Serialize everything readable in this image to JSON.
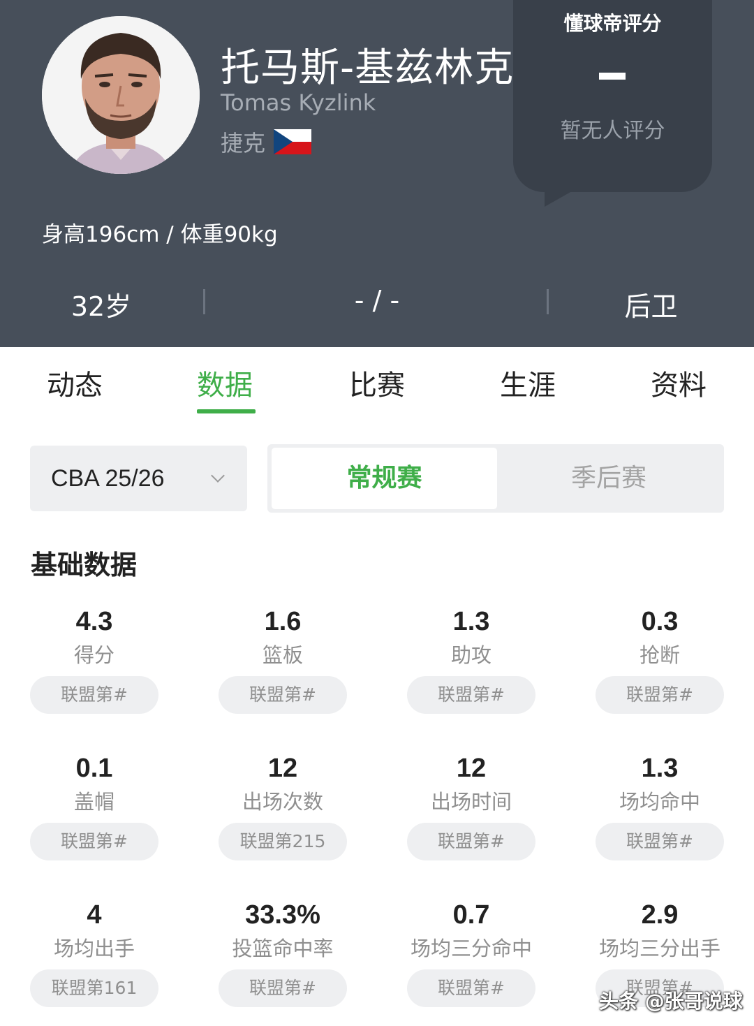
{
  "player": {
    "name_cn": "托马斯-基兹林克",
    "name_en": "Tomas Kyzlink",
    "country": "捷克",
    "body": "身高196cm / 体重90kg",
    "age": "32岁",
    "number_team": "- / -",
    "position": "后卫"
  },
  "rating": {
    "title": "懂球帝评分",
    "value": "-",
    "subtitle": "暂无人评分"
  },
  "tabs": [
    {
      "label": "动态"
    },
    {
      "label": "数据",
      "active": true
    },
    {
      "label": "比赛"
    },
    {
      "label": "生涯"
    },
    {
      "label": "资料"
    }
  ],
  "filters": {
    "season": "CBA 25/26",
    "segments": [
      "常规赛",
      "季后赛"
    ],
    "active_segment": "常规赛"
  },
  "section_title": "基础数据",
  "stats": [
    {
      "value": "4.3",
      "label": "得分",
      "rank": "联盟第#"
    },
    {
      "value": "1.6",
      "label": "篮板",
      "rank": "联盟第#"
    },
    {
      "value": "1.3",
      "label": "助攻",
      "rank": "联盟第#"
    },
    {
      "value": "0.3",
      "label": "抢断",
      "rank": "联盟第#"
    },
    {
      "value": "0.1",
      "label": "盖帽",
      "rank": "联盟第#"
    },
    {
      "value": "12",
      "label": "出场次数",
      "rank": "联盟第215"
    },
    {
      "value": "12",
      "label": "出场时间",
      "rank": "联盟第#"
    },
    {
      "value": "1.3",
      "label": "场均命中",
      "rank": "联盟第#"
    },
    {
      "value": "4",
      "label": "场均出手",
      "rank": "联盟第161"
    },
    {
      "value": "33.3%",
      "label": "投篮命中率",
      "rank": "联盟第#"
    },
    {
      "value": "0.7",
      "label": "场均三分命中",
      "rank": "联盟第#"
    },
    {
      "value": "2.9",
      "label": "场均三分出手",
      "rank": "联盟第#"
    }
  ],
  "watermark": "头条 @张哥说球",
  "colors": {
    "header_bg": "#474f5a",
    "accent": "#3fae49",
    "chip_bg": "#eeeff1"
  }
}
